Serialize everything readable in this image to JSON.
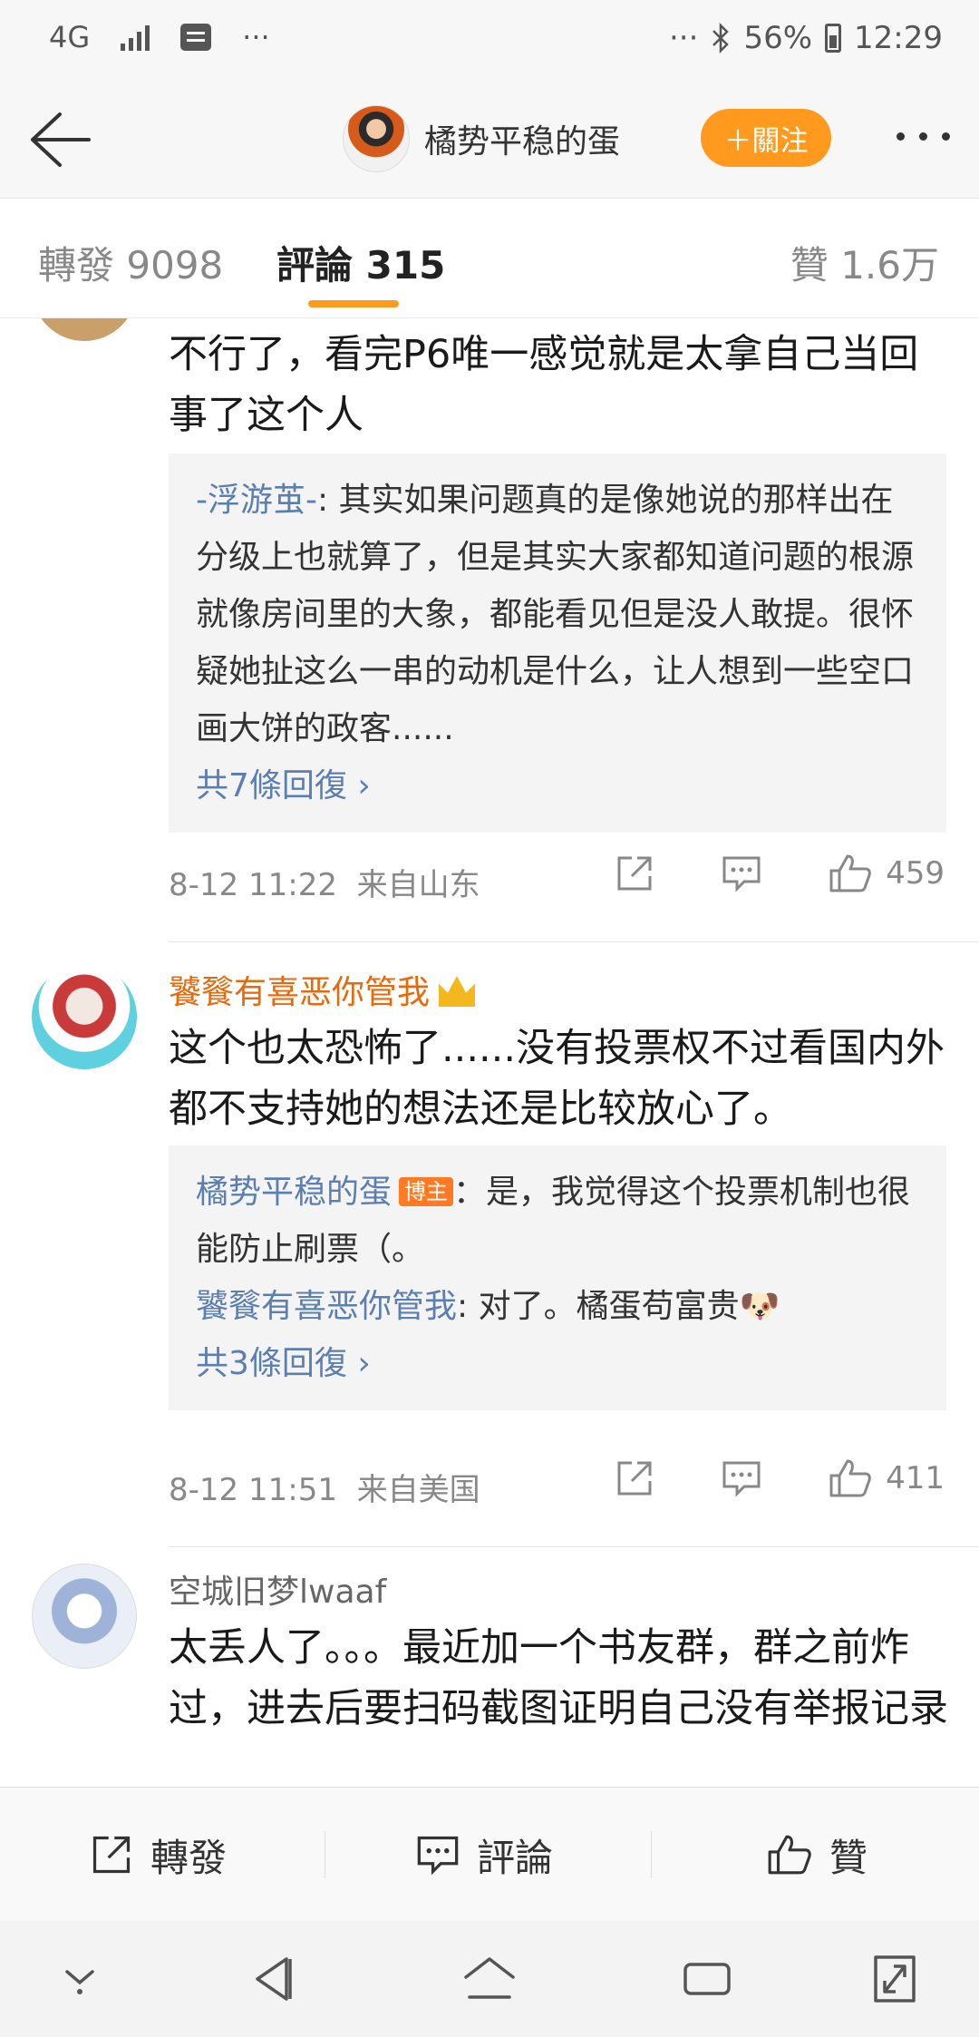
{
  "status_bar": {
    "network": "4G",
    "battery": "56%",
    "time": "12:29",
    "dots_left": "···",
    "dots_right": "···"
  },
  "nav": {
    "title": "橘势平稳的蛋",
    "follow_label": "＋關注"
  },
  "tabs": [
    {
      "label": "轉發 9098"
    },
    {
      "label": "評論 315"
    },
    {
      "label": "贊 1.6万"
    }
  ],
  "comments": [
    {
      "text": "不行了，看完P6唯一感觉就是太拿自己当回事了这个人",
      "replies": [
        {
          "name": "-浮游茧-",
          "text": ": 其实如果问题真的是像她说的那样出在分级上也就算了，但是其实大家都知道问题的根源就像房间里的大象，都能看见但是没人敢提。很怀疑她扯这么一串的动机是什么，让人想到一些空口画大饼的政客......"
        }
      ],
      "more_replies": "共7條回復 ›",
      "time": "8-12 11:22",
      "source": "来自山东",
      "likes": "459"
    },
    {
      "name": "饕餮有喜恶你管我",
      "text": "这个也太恐怖了......没有投票权不过看国内外都不支持她的想法还是比较放心了。",
      "replies": [
        {
          "name": "橘势平稳的蛋",
          "badge": "博主",
          "text": "：是，我觉得这个投票机制也很能防止刷票（。"
        },
        {
          "name": "饕餮有喜恶你管我",
          "text": ": 对了。橘蛋苟富贵🐶"
        }
      ],
      "more_replies": "共3條回復 ›",
      "time": "8-12 11:51",
      "source": "来自美国",
      "likes": "411"
    },
    {
      "name": "空城旧梦lwaaf",
      "text": "太丢人了。。。最近加一个书友群，群之前炸过，进去后要扫码截图证明自己没有举报记录"
    }
  ],
  "bottom_bar": {
    "repost": "轉發",
    "comment": "評論",
    "like": "贊"
  },
  "colors": {
    "accent": "#ff9a1e",
    "link": "#5b7fb0",
    "vip_name": "#e8680c"
  }
}
